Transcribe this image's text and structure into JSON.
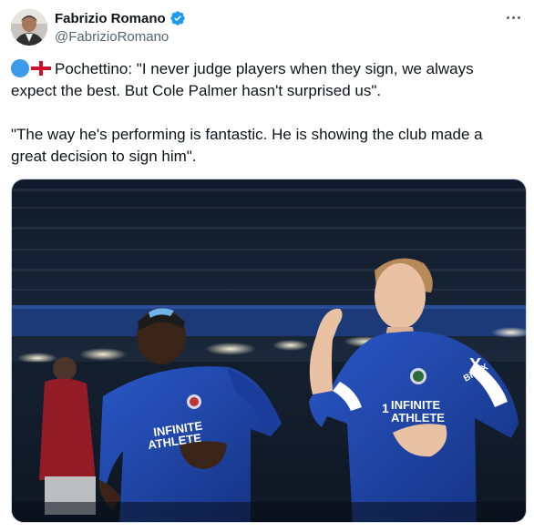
{
  "author": {
    "display_name": "Fabrizio Romano",
    "handle": "@FabrizioRomano",
    "verified": true,
    "avatar_icon": "profile-photo"
  },
  "tweet": {
    "line1": "Pochettino: \"I never judge players when they sign, we always",
    "line2": "expect the best. But Cole Palmer hasn't surprised us\".",
    "line3": "\"The way he's performing is fantastic. He is showing the club made a",
    "line4": "great decision to sign him\"."
  },
  "media": {
    "kit_text_left": "INFINITE ATHLETE",
    "kit_text_right": "INFINITE ATHLETE",
    "sponsor_sleeve": "BingX"
  },
  "colors": {
    "accent": "#1d9bf0",
    "chelsea_blue": "#1b3f9e",
    "text": "#0f1419",
    "muted": "#536471"
  }
}
